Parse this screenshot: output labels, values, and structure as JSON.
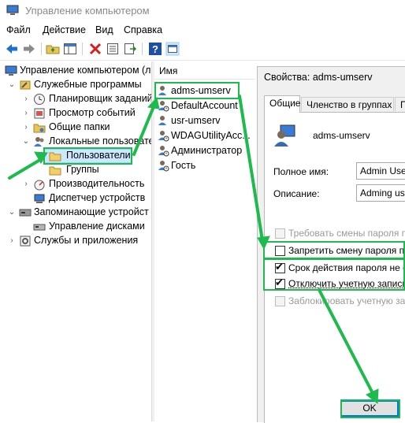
{
  "window": {
    "title": "Управление компьютером"
  },
  "menu": {
    "items": [
      "Файл",
      "Действие",
      "Вид",
      "Справка"
    ]
  },
  "toolbar": {
    "icons": [
      "back-arrow-icon",
      "forward-arrow-icon",
      "up-folder-icon",
      "show-hide-tree-icon",
      "delete-icon",
      "properties-icon",
      "export-icon",
      "help-icon",
      "view-icon"
    ]
  },
  "tree": {
    "items": [
      {
        "label": "Управление компьютером (л",
        "icon": "computer-icon"
      },
      {
        "label": "Служебные программы",
        "icon": "tools-icon"
      },
      {
        "label": "Планировщик заданий",
        "icon": "clock-icon"
      },
      {
        "label": "Просмотр событий",
        "icon": "event-viewer-icon"
      },
      {
        "label": "Общие папки",
        "icon": "shared-folder-icon"
      },
      {
        "label": "Локальные пользовате",
        "icon": "users-icon"
      },
      {
        "label": "Пользователи",
        "icon": "folder-icon"
      },
      {
        "label": "Группы",
        "icon": "folder-icon"
      },
      {
        "label": "Производительность",
        "icon": "performance-icon"
      },
      {
        "label": "Диспетчер устройств",
        "icon": "device-manager-icon"
      },
      {
        "label": "Запоминающие устройст",
        "icon": "storage-icon"
      },
      {
        "label": "Управление дисками",
        "icon": "disk-icon"
      },
      {
        "label": "Службы и приложения",
        "icon": "services-icon"
      }
    ]
  },
  "list": {
    "column_header": "Имя",
    "users": [
      "adms-umserv",
      "DefaultAccount",
      "usr-umserv",
      "WDAGUtilityAcc...",
      "Администратор",
      "Гость"
    ]
  },
  "dialog": {
    "title": "Свойства: adms-umserv",
    "tabs": [
      "Общие",
      "Членство в группах",
      "Про"
    ],
    "username": "adms-umserv",
    "full_name_label": "Полное имя:",
    "full_name_value": "Admin User",
    "description_label": "Описание:",
    "description_value": "Adming user",
    "checkboxes": [
      {
        "label": "Требовать смены пароля при",
        "checked": false,
        "enabled": false
      },
      {
        "label": "Запретить смену пароля поль",
        "checked": false,
        "enabled": true
      },
      {
        "label": "Срок действия пароля не огра",
        "checked": true,
        "enabled": true
      },
      {
        "label": "Отключить учетную запись",
        "checked": true,
        "enabled": true
      },
      {
        "label": "Заблокировать учетную запис",
        "checked": false,
        "enabled": false
      }
    ],
    "ok_label": "OK"
  },
  "colors": {
    "highlight_green": "#1fba4d",
    "selection_blue": "#cce8ff",
    "ok_border": "#0078d7"
  }
}
